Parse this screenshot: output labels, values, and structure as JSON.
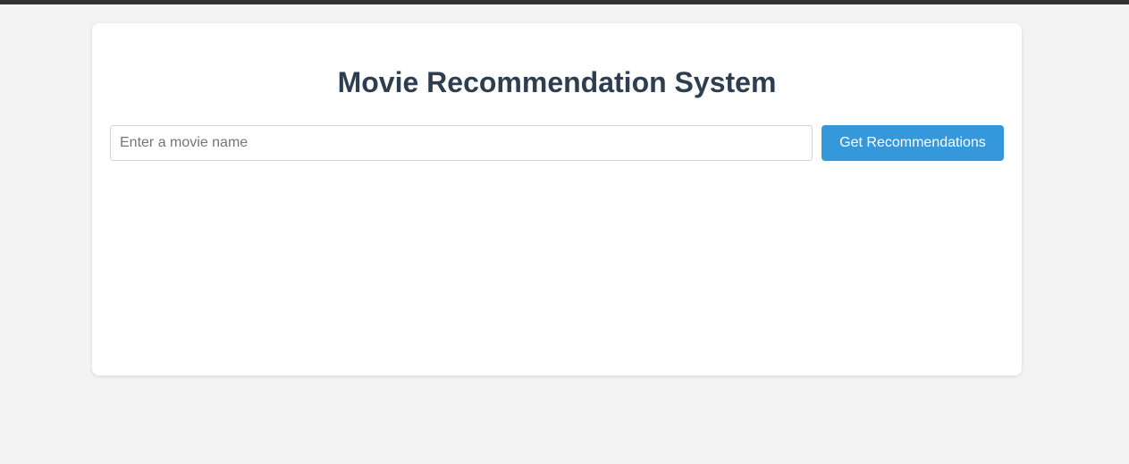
{
  "page": {
    "title": "Movie Recommendation System"
  },
  "search": {
    "placeholder": "Enter a movie name",
    "value": "",
    "button_label": "Get Recommendations"
  },
  "colors": {
    "background": "#f3f3f3",
    "top_bar": "#333333",
    "card": "#ffffff",
    "title": "#2c3e50",
    "button": "#3498db",
    "button_text": "#ffffff"
  },
  "results": []
}
